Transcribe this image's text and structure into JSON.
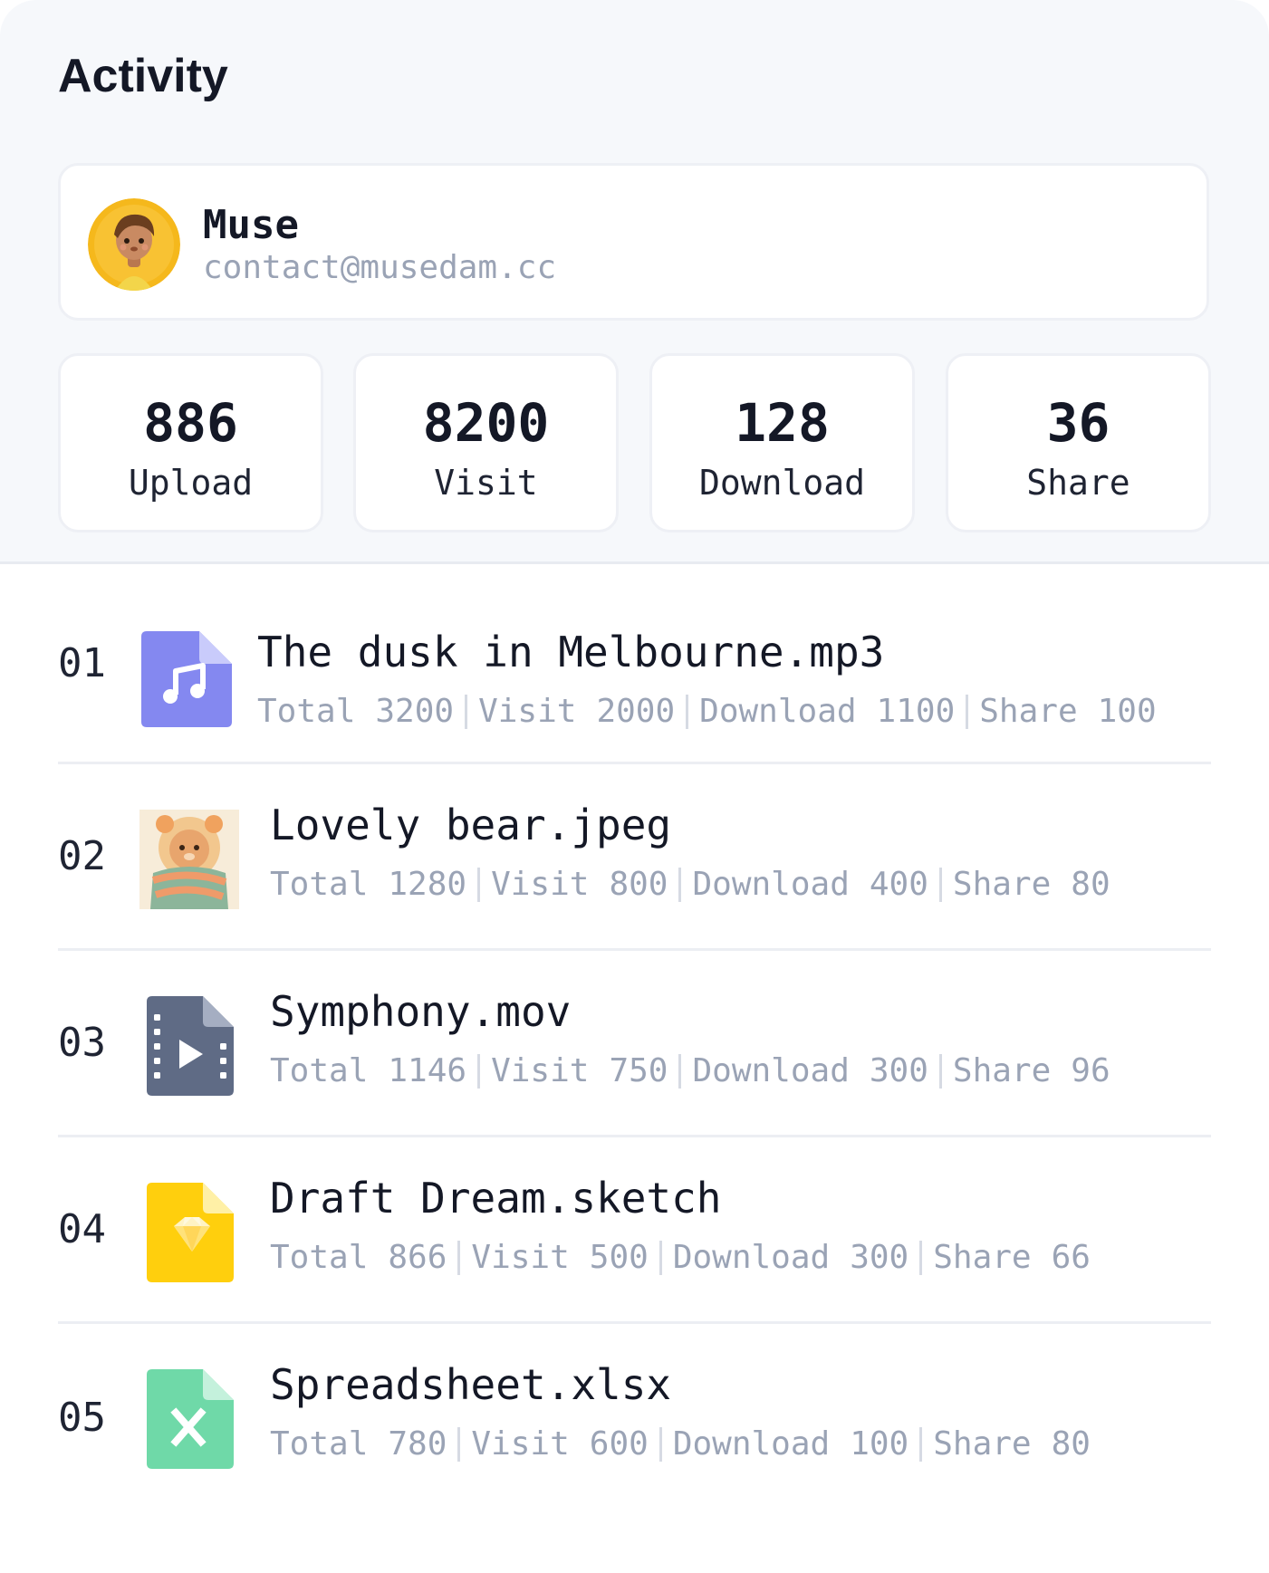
{
  "header": {
    "title": "Activity"
  },
  "profile": {
    "name": "Muse",
    "email": "contact@musedam.cc",
    "avatar_icon": "avatar-illustration"
  },
  "stats": [
    {
      "value": "886",
      "label": "Upload"
    },
    {
      "value": "8200",
      "label": "Visit"
    },
    {
      "value": "128",
      "label": "Download"
    },
    {
      "value": "36",
      "label": "Share"
    }
  ],
  "files": [
    {
      "rank": "01",
      "name": "The dusk in Melbourne.mp3",
      "icon": "audio-file-icon",
      "total_label": "Total",
      "total": "3200",
      "visit_label": "Visit",
      "visit": "2000",
      "download_label": "Download",
      "download": "1100",
      "share_label": "Share",
      "share": "100"
    },
    {
      "rank": "02",
      "name": "Lovely bear.jpeg",
      "icon": "image-thumbnail",
      "total_label": "Total",
      "total": "1280",
      "visit_label": "Visit",
      "visit": "800",
      "download_label": "Download",
      "download": "400",
      "share_label": "Share",
      "share": "80"
    },
    {
      "rank": "03",
      "name": "Symphony.mov",
      "icon": "video-file-icon",
      "total_label": "Total",
      "total": "1146",
      "visit_label": "Visit",
      "visit": "750",
      "download_label": "Download",
      "download": "300",
      "share_label": "Share",
      "share": "96"
    },
    {
      "rank": "04",
      "name": "Draft Dream.sketch",
      "icon": "sketch-file-icon",
      "total_label": "Total",
      "total": "866",
      "visit_label": "Visit",
      "visit": "500",
      "download_label": "Download",
      "download": "300",
      "share_label": "Share",
      "share": "66"
    },
    {
      "rank": "05",
      "name": "Spreadsheet.xlsx",
      "icon": "excel-file-icon",
      "total_label": "Total",
      "total": "780",
      "visit_label": "Visit",
      "visit": "600",
      "download_label": "Download",
      "download": "100",
      "share_label": "Share",
      "share": "80"
    }
  ],
  "colors": {
    "background_top": "#f6f8fb",
    "text_primary": "#141826",
    "text_muted": "#9aa3b5",
    "audio_icon": "#8488f0",
    "video_icon": "#5f6b85",
    "sketch_icon": "#ffcf0d",
    "excel_icon": "#6fd9a8"
  }
}
